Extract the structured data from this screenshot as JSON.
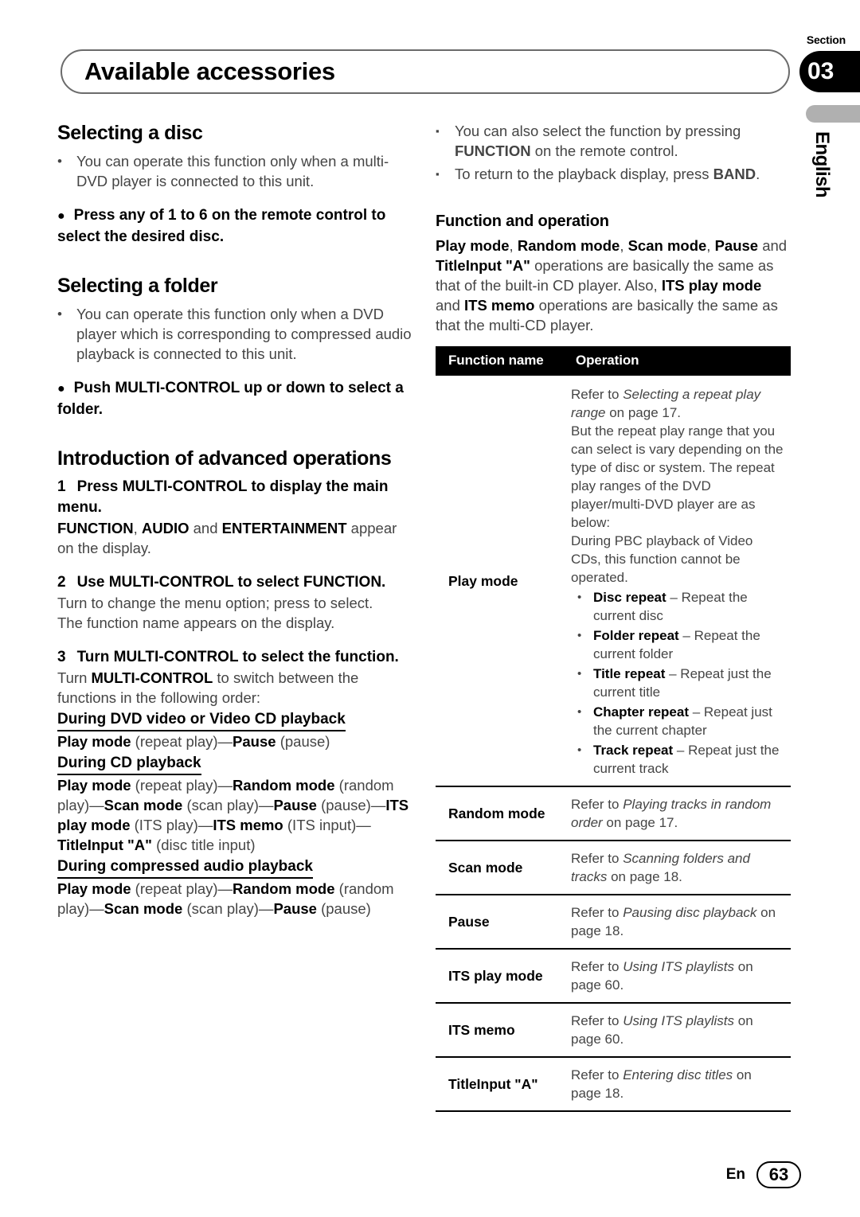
{
  "header": {
    "title": "Available accessories",
    "section_label": "Section",
    "section_number": "03",
    "language_tab": "English"
  },
  "left_column": {
    "heading_selecting_disc": "Selecting a disc",
    "note_disc": "You can operate this function only when a multi-DVD player is connected to this unit.",
    "proc_disc": "Press any of 1 to 6 on the remote control to select the desired disc.",
    "heading_selecting_folder": "Selecting a folder",
    "note_folder": "You can operate this function only when a DVD player which is corresponding to compressed audio playback is connected to this unit.",
    "proc_folder": "Push MULTI-CONTROL up or down to select a folder.",
    "heading_intro": "Introduction of advanced operations",
    "step1_num": "1",
    "step1_title": "Press MULTI-CONTROL to display the main menu.",
    "step1_body_html": "<b>FUNCTION</b>, <b>AUDIO</b> and <b>ENTERTAINMENT</b> appear on the display.",
    "step2_num": "2",
    "step2_title": "Use MULTI-CONTROL to select FUNCTION.",
    "step2_body_line1": "Turn to change the menu option; press to select.",
    "step2_body_line2": "The function name appears on the display.",
    "step3_num": "3",
    "step3_title": "Turn MULTI-CONTROL to select the function.",
    "step3_body_html": "Turn <b>MULTI-CONTROL</b> to switch between the functions in the following order:",
    "order_heading_dvd": "During DVD video or Video CD playback",
    "order_dvd_html": "<b>Play mode</b> (repeat play)—<b>Pause</b> (pause)",
    "order_heading_cd": "During CD playback",
    "order_cd_html": "<b>Play mode</b> (repeat play)—<b>Random mode</b> (random play)—<b>Scan mode</b> (scan play)—<b>Pause</b> (pause)—<b>ITS play mode</b> (ITS play)—<b>ITS memo</b> (ITS input)—<b>TitleInput \"A\"</b> (disc title input)",
    "order_heading_compressed": "During compressed audio playback",
    "order_compressed_html": "<b>Play mode</b> (repeat play)—<b>Random mode</b> (random play)—<b>Scan mode</b> (scan play)—<b>Pause</b> (pause)"
  },
  "right_column": {
    "note1_html": "You can also select the function by pressing <b>FUNCTION</b> on the remote control.",
    "note2_html": "To return to the playback display, press <b>BAND</b>.",
    "heading_function_operation": "Function and operation",
    "intro_html": "<b>Play mode</b>, <b>Random mode</b>, <b>Scan mode</b>, <b>Pause</b> and <b>TitleInput \"A\"</b> operations are basically the same as that of the built-in CD player. Also, <b>ITS play mode</b> and <b>ITS memo</b> operations are basically the same as that the multi-CD player."
  },
  "table": {
    "headers": [
      "Function name",
      "Operation"
    ],
    "rows": [
      {
        "name": "Play mode",
        "operation_html": "Refer to <i>Selecting a repeat play range</i> on page 17.<br>But the repeat play range that you can select is vary depending on the type of disc or system. The repeat play ranges of the DVD player/multi-DVD player are as below:<br>During PBC playback of Video CDs, this function cannot be operated.",
        "bullets": [
          {
            "term": "Disc repeat",
            "desc": "– Repeat the current disc"
          },
          {
            "term": "Folder repeat",
            "desc": "– Repeat the current folder"
          },
          {
            "term": "Title repeat",
            "desc": "– Repeat just the current title"
          },
          {
            "term": "Chapter repeat",
            "desc": "– Repeat just the current chapter"
          },
          {
            "term": "Track repeat",
            "desc": "– Repeat just the current track"
          }
        ]
      },
      {
        "name": "Random mode",
        "operation_html": "Refer to <i>Playing tracks in random order</i> on page 17.",
        "bullets": []
      },
      {
        "name": "Scan mode",
        "operation_html": "Refer to <i>Scanning folders and tracks</i> on page 18.",
        "bullets": []
      },
      {
        "name": "Pause",
        "operation_html": "Refer to <i>Pausing disc playback</i> on page 18.",
        "bullets": []
      },
      {
        "name": "ITS play mode",
        "operation_html": "Refer to <i>Using ITS playlists</i> on page 60.",
        "bullets": []
      },
      {
        "name": "ITS memo",
        "operation_html": "Refer to <i>Using ITS playlists</i> on page 60.",
        "bullets": []
      },
      {
        "name": "TitleInput \"A\"",
        "operation_html": "Refer to <i>Entering disc titles</i> on page 18.",
        "bullets": []
      }
    ]
  },
  "footer": {
    "language": "En",
    "page_number": "63"
  },
  "icons": {
    "round_bullet": "•",
    "square_bullet": "▪",
    "filled_circle_bullet": "●"
  },
  "colors": {
    "text": "#000000",
    "body_text": "#454545",
    "badge_bg": "#000000",
    "lang_tab": "#b0b0b0"
  }
}
